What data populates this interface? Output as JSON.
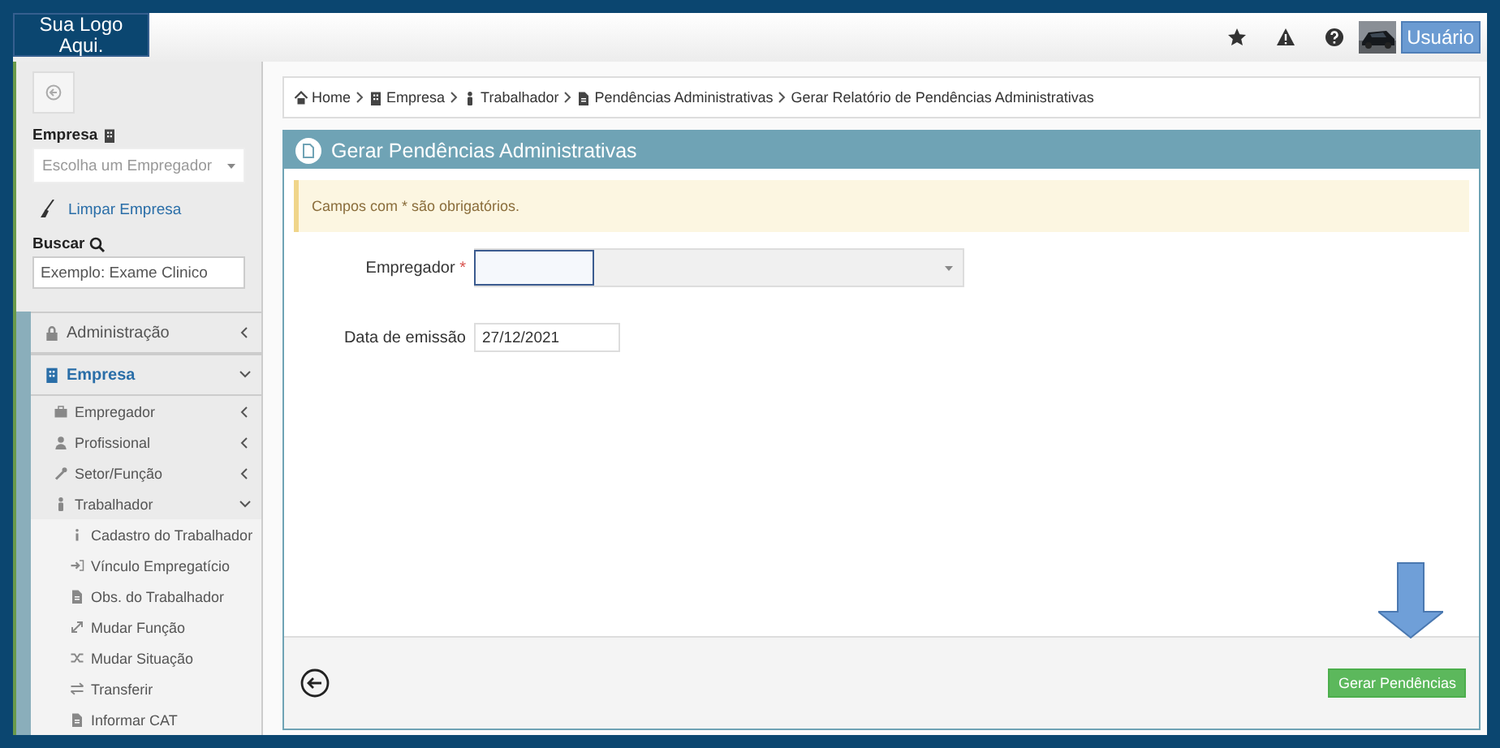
{
  "logo": "Sua Logo Aqui.",
  "topbar": {
    "user_button": "Usuário"
  },
  "sidebar": {
    "company_label": "Empresa",
    "company_select": {
      "placeholder": "Escolha um Empregador"
    },
    "clear_link": "Limpar Empresa",
    "search_label": "Buscar",
    "search": {
      "placeholder": "Exemplo: Exame Clinico"
    },
    "menu": [
      {
        "label": "Administração",
        "expanded": false
      },
      {
        "label": "Empresa",
        "expanded": true,
        "children": [
          {
            "label": "Empregador",
            "expanded": false
          },
          {
            "label": "Profissional",
            "expanded": false
          },
          {
            "label": "Setor/Função",
            "expanded": false
          },
          {
            "label": "Trabalhador",
            "expanded": true,
            "children": [
              {
                "label": "Cadastro do Trabalhador"
              },
              {
                "label": "Vínculo Empregatício"
              },
              {
                "label": "Obs. do Trabalhador"
              },
              {
                "label": "Mudar Função"
              },
              {
                "label": "Mudar Situação"
              },
              {
                "label": "Transferir"
              },
              {
                "label": "Informar CAT"
              }
            ]
          }
        ]
      }
    ]
  },
  "breadcrumb": [
    {
      "label": "Home"
    },
    {
      "label": "Empresa"
    },
    {
      "label": "Trabalhador"
    },
    {
      "label": "Pendências Administrativas"
    },
    {
      "label": "Gerar Relatório de Pendências Administrativas"
    }
  ],
  "panel": {
    "title": "Gerar Pendências Administrativas",
    "notice": "Campos com * são obrigatórios.",
    "fields": [
      {
        "label": "Empregador",
        "required": "*",
        "kind": "select"
      },
      {
        "label": "Data de emissão",
        "kind": "date",
        "value": "27/12/2021"
      }
    ],
    "submit": "Gerar Pendências"
  }
}
